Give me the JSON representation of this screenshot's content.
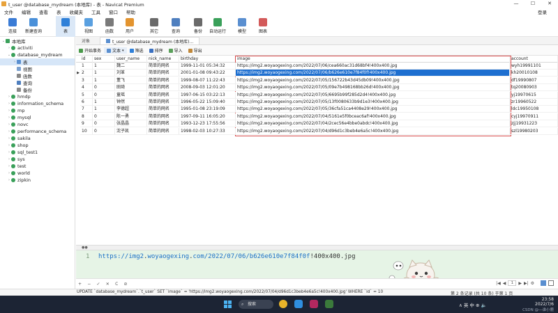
{
  "window": {
    "title": "t_user @database_mydream (本地库) - 表 - Navicat Premium",
    "controls": [
      "—",
      "☐",
      "✕"
    ]
  },
  "menu": {
    "items": [
      "文件",
      "编辑",
      "查看",
      "表",
      "收藏夹",
      "工具",
      "窗口",
      "帮助"
    ],
    "login": "登录"
  },
  "toolbar": {
    "buttons": [
      {
        "label": "连接",
        "icon": "plug-icon",
        "color": "#3a7bd5"
      },
      {
        "label": "新建查询",
        "icon": "new-query-icon",
        "color": "#4a90d9"
      },
      {
        "label": "表",
        "icon": "table-icon",
        "color": "#2f80d8",
        "active": true
      },
      {
        "label": "视图",
        "icon": "view-icon",
        "color": "#5aa0e0"
      },
      {
        "label": "函数",
        "icon": "function-icon",
        "color": "#7a7a7a"
      },
      {
        "label": "用户",
        "icon": "user-icon",
        "color": "#e3942f"
      },
      {
        "label": "其它",
        "icon": "other-icon",
        "color": "#6a6a6a"
      },
      {
        "label": "查询",
        "icon": "query-icon",
        "color": "#4f7fbf"
      },
      {
        "label": "备份",
        "icon": "backup-icon",
        "color": "#6a6a6a"
      },
      {
        "label": "自动运行",
        "icon": "auto-run-icon",
        "color": "#3aa05a"
      },
      {
        "label": "模型",
        "icon": "model-icon",
        "color": "#5a8fd0"
      },
      {
        "label": "图表",
        "icon": "chart-icon",
        "color": "#d35a5a"
      }
    ]
  },
  "sidebar": {
    "items": [
      {
        "label": "本地库",
        "level": 0,
        "kind": "connection",
        "expanded": true
      },
      {
        "label": "activiti",
        "level": 1,
        "kind": "db"
      },
      {
        "label": "database_mydream",
        "level": 1,
        "kind": "db",
        "expanded": true
      },
      {
        "label": "表",
        "level": 2,
        "kind": "tables",
        "selected": true
      },
      {
        "label": "视图",
        "level": 2,
        "kind": "views"
      },
      {
        "label": "函数",
        "level": 2,
        "kind": "functions"
      },
      {
        "label": "查询",
        "level": 2,
        "kind": "queries"
      },
      {
        "label": "备份",
        "level": 2,
        "kind": "backups"
      },
      {
        "label": "hmdp",
        "level": 1,
        "kind": "db"
      },
      {
        "label": "information_schema",
        "level": 1,
        "kind": "db"
      },
      {
        "label": "mp",
        "level": 1,
        "kind": "db"
      },
      {
        "label": "mysql",
        "level": 1,
        "kind": "db"
      },
      {
        "label": "novc",
        "level": 1,
        "kind": "db"
      },
      {
        "label": "performance_schema",
        "level": 1,
        "kind": "db"
      },
      {
        "label": "sakila",
        "level": 1,
        "kind": "db"
      },
      {
        "label": "shop",
        "level": 1,
        "kind": "db"
      },
      {
        "label": "sql_test1",
        "level": 1,
        "kind": "db"
      },
      {
        "label": "sys",
        "level": 1,
        "kind": "db"
      },
      {
        "label": "test",
        "level": 1,
        "kind": "db"
      },
      {
        "label": "world",
        "level": 1,
        "kind": "db"
      },
      {
        "label": "zipkin",
        "level": 1,
        "kind": "db"
      }
    ]
  },
  "tabs": [
    {
      "label": "对象"
    },
    {
      "label": "t_user @database_mydream (本地库)..."
    }
  ],
  "actions": [
    "开始事务",
    "文本",
    "筛选",
    "排序",
    "导入",
    "导出"
  ],
  "table": {
    "columns": [
      "id",
      "sex",
      "user_name",
      "nick_name",
      "birthday",
      "image",
      "account"
    ],
    "rows": [
      [
        "1",
        "1",
        "魏二",
        "简单的网名",
        "1999-11-01 05:34:32",
        "https://img2.woyaogexing.com/2022/07/06/cea660ac31d68bf4!400x400.jpg",
        "wyh19991101"
      ],
      [
        "2",
        "1",
        "刘革",
        "简单的网名",
        "2001-01-08 09:43:22",
        "https://img2.woyaogexing.com/2022/07/06/b626e610e7f84f0f!400x400.jpg",
        "kh20010108"
      ],
      [
        "3",
        "1",
        "董飞",
        "简单的网名",
        "1999-08-07 11:22:43",
        "https://img2.woyaogexing.com/2022/07/05/156722b43d45db09!400x400.jpg",
        "df19990807"
      ],
      [
        "4",
        "0",
        "田琦",
        "简单的网名",
        "2008-09-03 12:01:20",
        "https://img2.woyaogexing.com/2022/07/05/09e7b498168bb26d!400x400.jpg",
        "tq20080903"
      ],
      [
        "5",
        "0",
        "童瑶",
        "简单的网名",
        "1997-06-15 03:22:13",
        "https://img2.woyaogexing.com/2022/07/05/6695b99f285d2d4!400x400.jpg",
        "yj19970615"
      ],
      [
        "6",
        "1",
        "钟然",
        "简单的网名",
        "1996-05-22 15:09:40",
        "https://img2.woyaogexing.com/2022/07/05/13f0080633b9d1e3!400x400.jpg",
        "zr19960522"
      ],
      [
        "7",
        "1",
        "李德超",
        "简单的网名",
        "1995-01-08 23:19:09",
        "https://img2.woyaogexing.com/2022/07/05/36cfa51ca4408e29!400x400.jpg",
        "ldc19950108"
      ],
      [
        "8",
        "0",
        "陈一勇",
        "简单的网名",
        "1997-09-11 16:05:20",
        "https://img2.woyaogexing.com/2022/07/04/5161e5f0bceac6af!400x400.jpg",
        "cyj19970911"
      ],
      [
        "9",
        "0",
        "张晶晶",
        "简单的网名",
        "1993-12-23 17:55:56",
        "https://img2.woyaogexing.com/2022/07/04/2cec56e4bbe0abdc!400x400.jpg",
        "zjj19931223"
      ],
      [
        "10",
        "0",
        "沈子凯",
        "简单的网名",
        "1998-02-03 10:27:33",
        "https://img2.woyaogexing.com/2022/07/04/d96d1c3beb4e6a5c!400x400.jpg",
        "szl19980203"
      ]
    ],
    "selected_row_index": 1
  },
  "editor": {
    "line_number": "1",
    "url_parts": {
      "scheme": "https://",
      "host1": "img2",
      "dot1": ".",
      "host2": "woyaogexing",
      "dot2": ".",
      "host3": "com",
      "path": "/2022/07/06/",
      "hash": "b626e610e7f84f0f",
      "tail": "!400x400.jpg"
    }
  },
  "bottom": {
    "left_icons": [
      "+",
      "−",
      "✓",
      "✕",
      "C",
      "⊘"
    ],
    "nav": [
      "|◀",
      "◀",
      "1",
      "▶",
      "▶|",
      "⚙"
    ]
  },
  "status": {
    "sql": "UPDATE `database_mydream`.`t_user` SET `image` = 'https://img2.woyaogexing.com/2022/07/04/d96d1c3beb4e6a5c!400x400.jpg' WHERE `id` = 10",
    "records": "第 2 条记录 (共 10 条) 于第 1 页"
  },
  "taskbar": {
    "search": "搜索",
    "tray": "∧ 英 中 ⊕ 🔈",
    "time": "23:58",
    "date": "2022/7/6",
    "watermark": "CSDN @—谁小鹿"
  }
}
